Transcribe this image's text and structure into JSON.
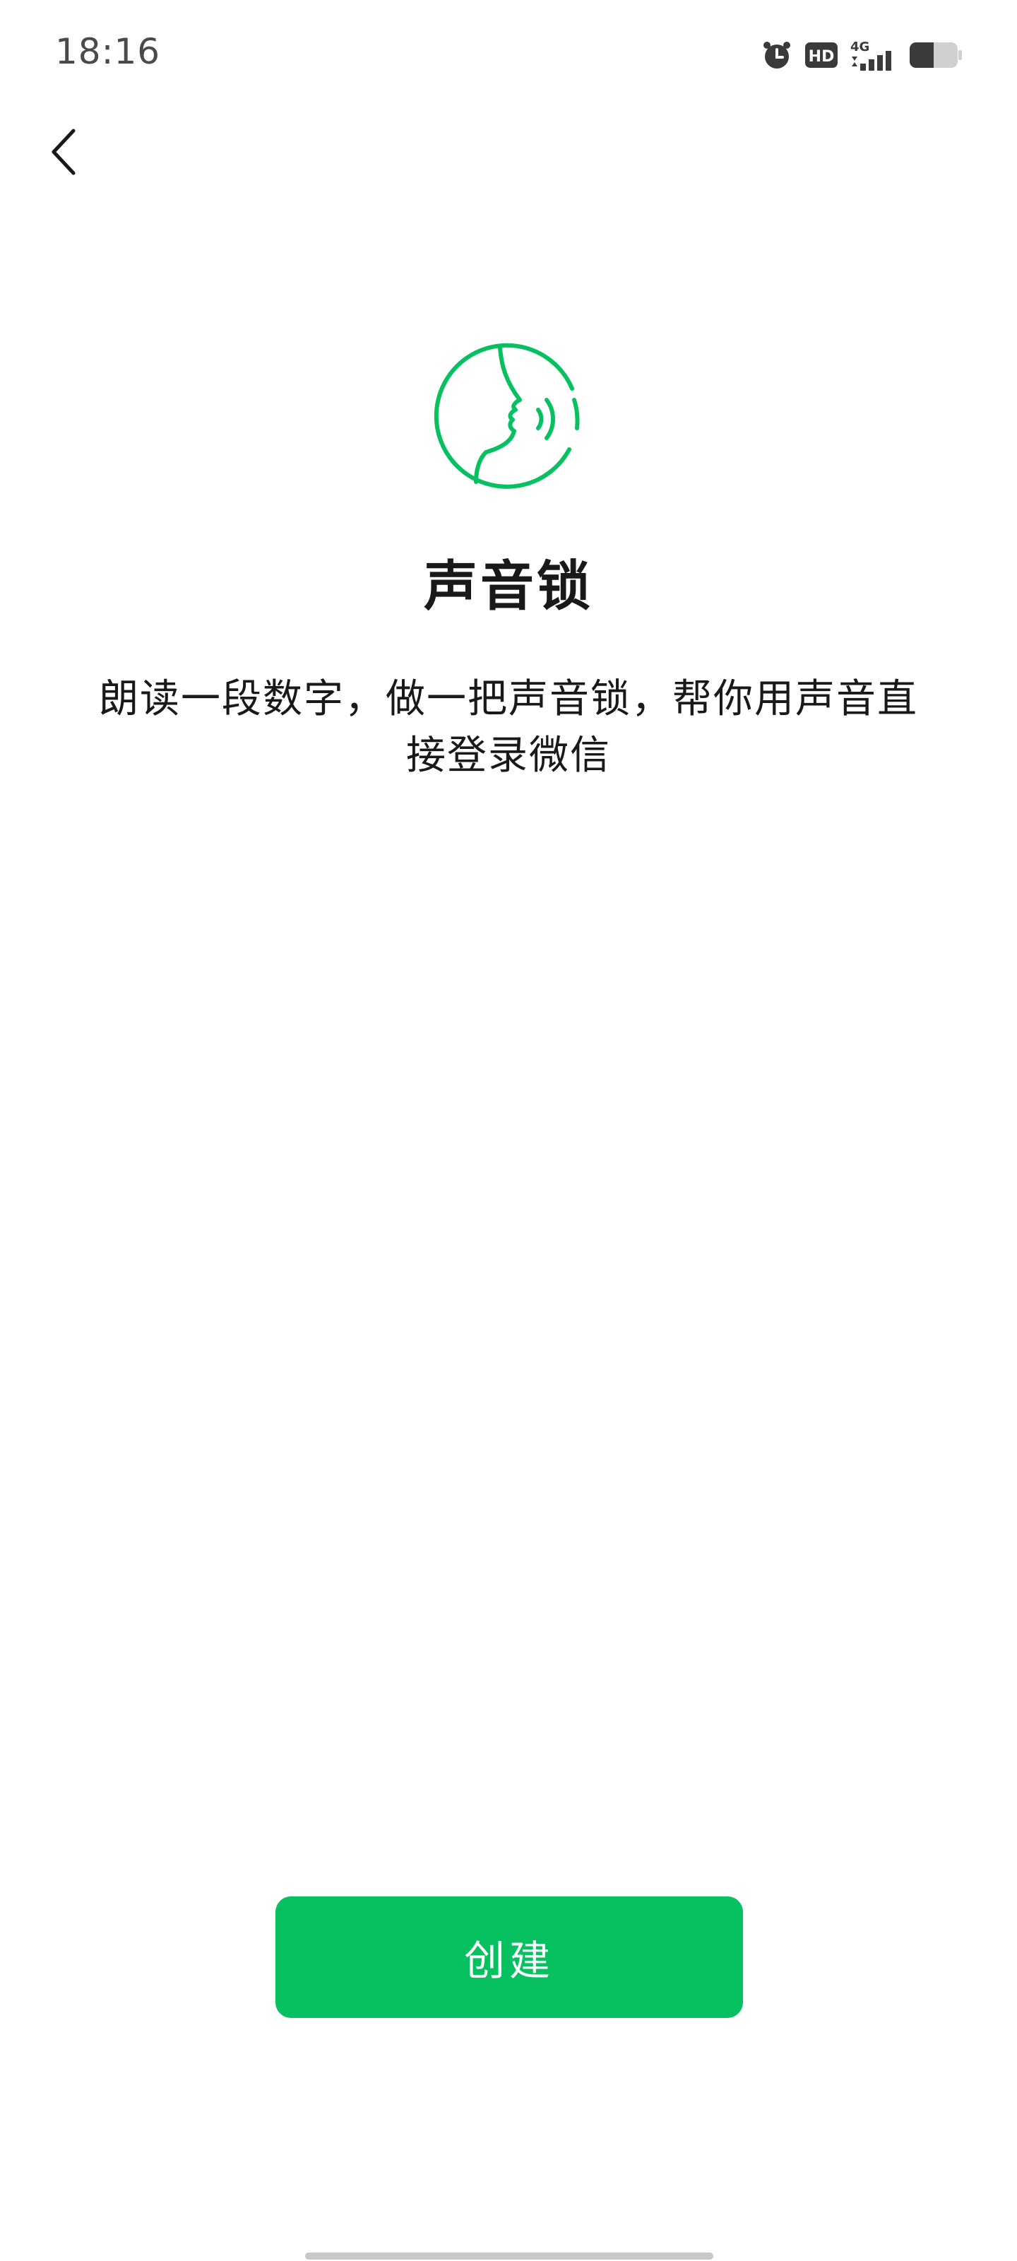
{
  "status_bar": {
    "time": "18:16",
    "icons": [
      "alarm-icon",
      "hd-icon",
      "4g-signal-icon",
      "battery-icon"
    ],
    "hd_label": "HD",
    "network_label": "4G"
  },
  "nav": {
    "back_icon": "chevron-left-icon"
  },
  "hero": {
    "icon": "voice-face-icon",
    "title": "声音锁",
    "description": "朗读一段数字，做一把声音锁，帮你用声音直接登录微信"
  },
  "actions": {
    "create_label": "创建"
  },
  "colors": {
    "accent": "#07c160",
    "text": "#191919",
    "status_text": "#4a4a4a"
  }
}
